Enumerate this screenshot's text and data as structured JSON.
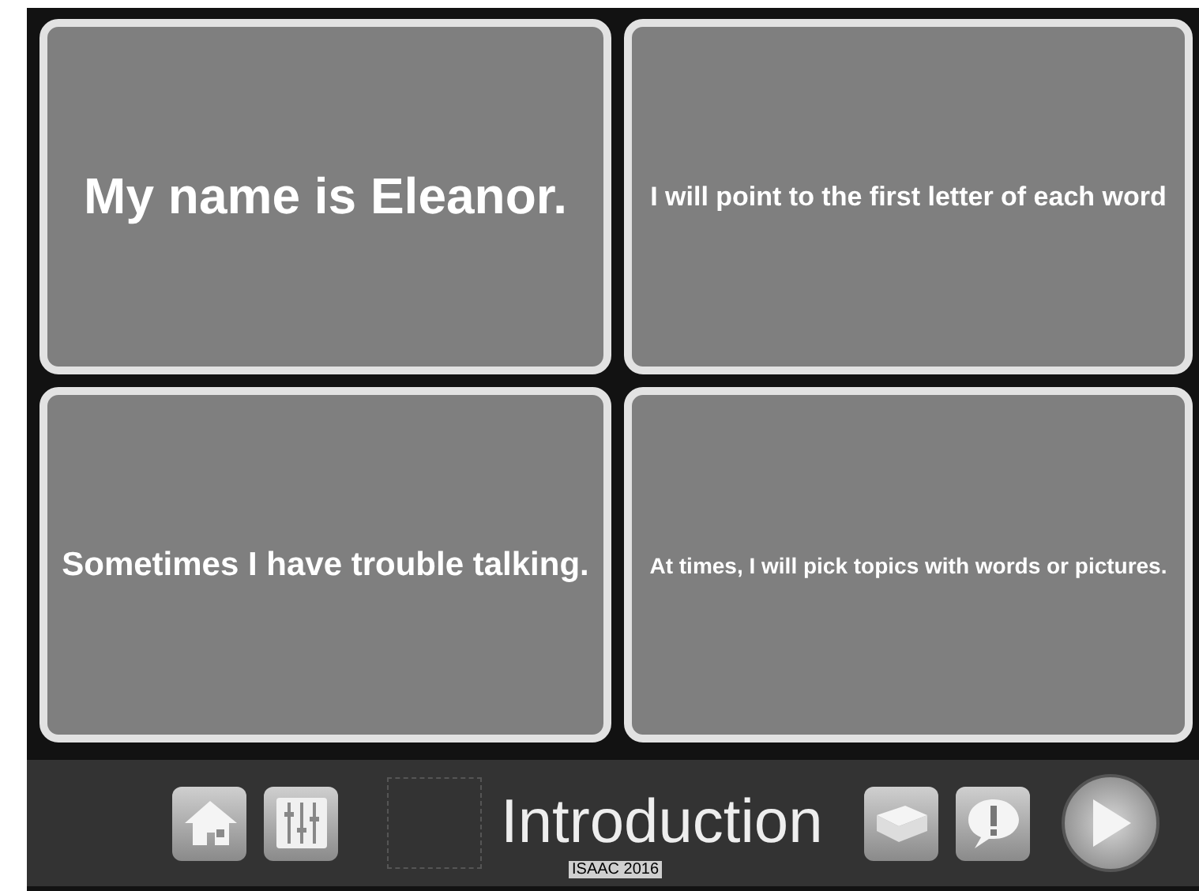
{
  "tiles": [
    {
      "text": "My name is Eleanor."
    },
    {
      "text": "I will point to the first letter of each word"
    },
    {
      "text": "Sometimes I have trouble talking."
    },
    {
      "text": "At times, I will pick topics with words or pictures."
    }
  ],
  "toolbar": {
    "title": "Introduction",
    "caption": "ISAAC 2016"
  }
}
